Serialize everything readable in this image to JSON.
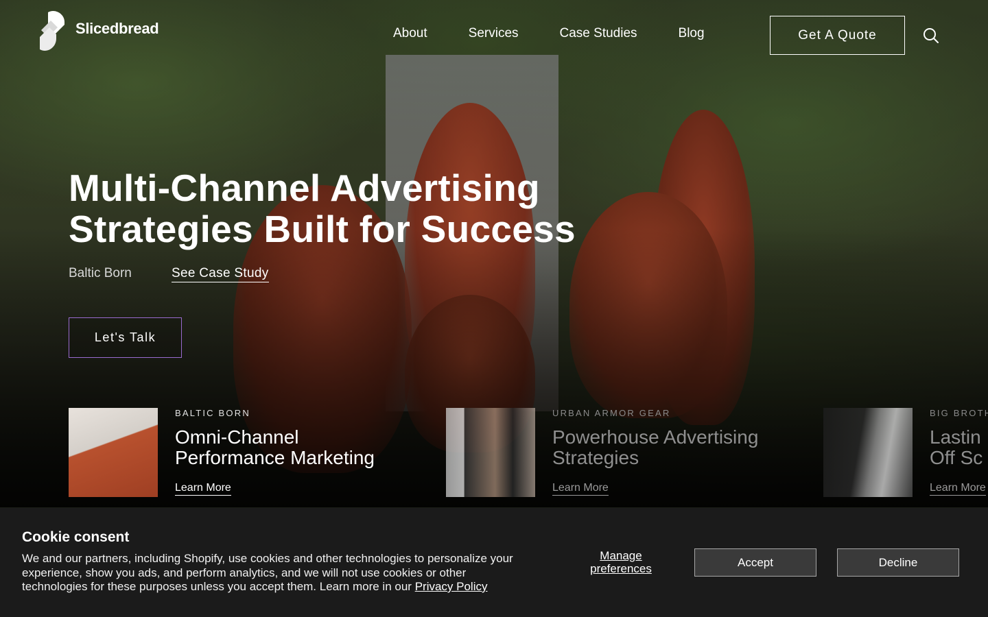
{
  "brand": {
    "name": "Slicedbread"
  },
  "nav": {
    "items": [
      {
        "label": "About"
      },
      {
        "label": "Services"
      },
      {
        "label": "Case Studies"
      },
      {
        "label": "Blog"
      }
    ],
    "quote_label": "Get A Quote",
    "search_icon": "search-icon"
  },
  "hero": {
    "title": "Multi-Channel Advertising Strategies Built for Success",
    "client": "Baltic Born",
    "case_link": "See Case Study",
    "cta_label": "Let's Talk"
  },
  "cases": [
    {
      "eyebrow": "BALTIC BORN",
      "title": "Omni-Channel Performance Marketing",
      "link": "Learn More"
    },
    {
      "eyebrow": "URBAN ARMOR GEAR",
      "title": "Powerhouse Advertising Strategies",
      "link": "Learn More"
    },
    {
      "eyebrow": "BIG BROTHE",
      "title": "Lastin Off Sc",
      "link": "Learn More"
    }
  ],
  "cookie": {
    "title": "Cookie consent",
    "body": "We and our partners, including Shopify, use cookies and other technologies to personalize your experience, show you ads, and perform analytics, and we will not use cookies or other technologies for these purposes unless you accept them. Learn more in our",
    "privacy_link": "Privacy Policy",
    "manage_label": "Manage preferences",
    "accept_label": "Accept",
    "decline_label": "Decline"
  },
  "colors": {
    "cta_border": "#9a6bd0",
    "banner_bg": "#1b1b1b",
    "banner_button_bg": "#3a3a3a"
  }
}
